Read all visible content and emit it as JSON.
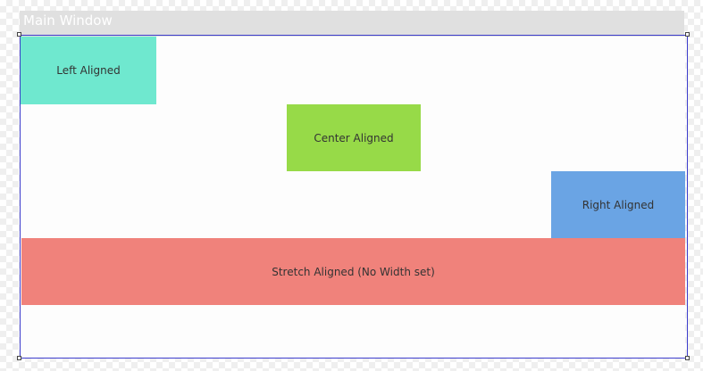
{
  "window": {
    "title": "Main Window"
  },
  "colors": {
    "title_bar": "#e0e0e0",
    "client_bg": "#fdfdfd",
    "selection_border": "#3c3ccc",
    "left_box": "#6fe8cf",
    "center_box": "#97da48",
    "right_box": "#6aa4e4",
    "stretch_box": "#f0827b"
  },
  "boxes": {
    "left": {
      "label": "Left Aligned"
    },
    "center": {
      "label": "Center Aligned"
    },
    "right": {
      "label": "Right Aligned"
    },
    "stretch": {
      "label": "Stretch Aligned (No Width set)"
    }
  }
}
